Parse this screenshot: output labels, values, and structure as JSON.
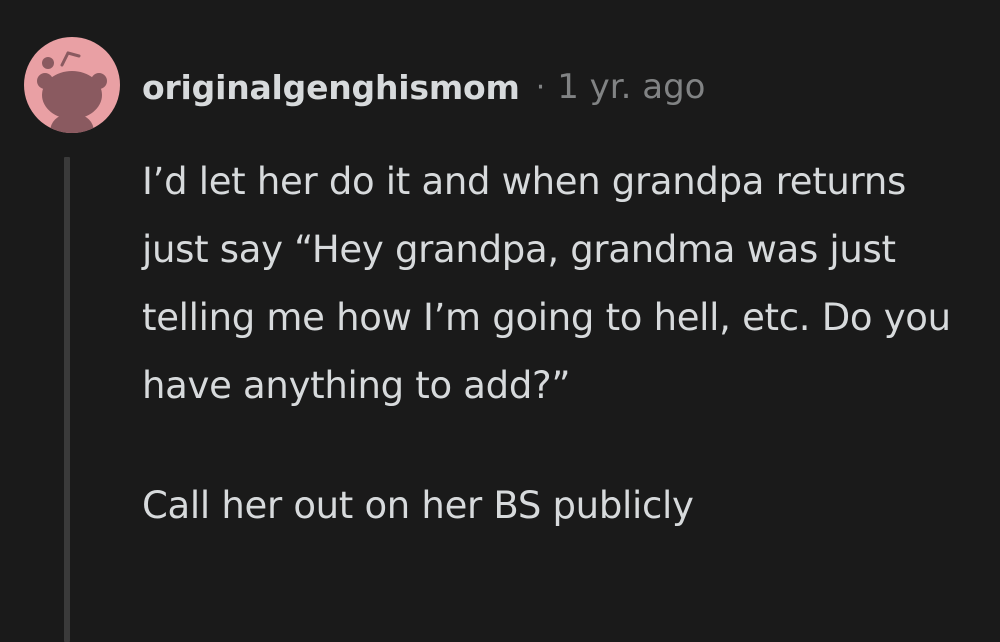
{
  "comment": {
    "author": "originalgenghismom",
    "separator": "·",
    "age": "1 yr. ago",
    "avatar_icon": "snoo-avatar-icon",
    "paragraphs": [
      "I’d let her do it and when grandpa returns just say “Hey grandpa, grandma was just telling me how I’m going to hell, etc. Do you have anything to add?”",
      "Call her out on her BS publicly"
    ]
  },
  "colors": {
    "background": "#1a1a1a",
    "text": "#d7dadc",
    "meta": "#818384",
    "avatar_bg": "#e9a0a4",
    "thread_line": "#3a3a3a"
  }
}
